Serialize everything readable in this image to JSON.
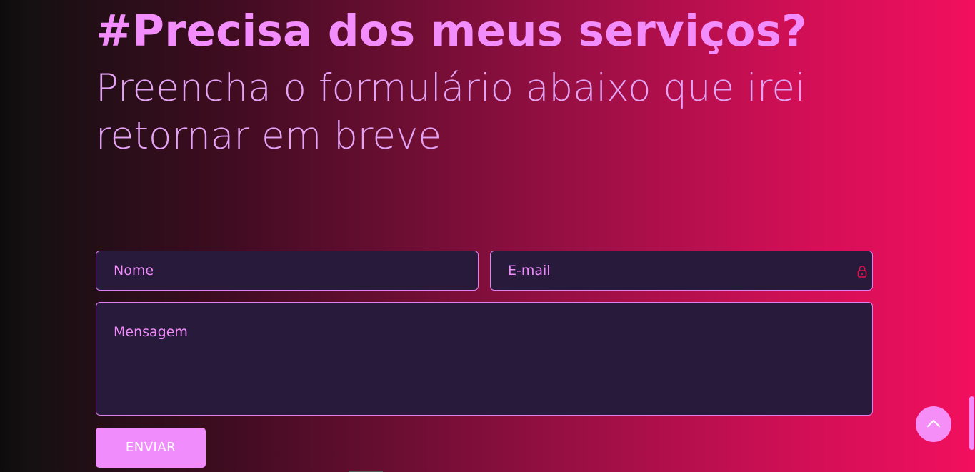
{
  "heading": {
    "title": "#Precisa dos meus serviços?",
    "subtitle": "Preencha o formulário abaixo que irei retornar em breve"
  },
  "form": {
    "name_placeholder": "Nome",
    "email_placeholder": "E-mail",
    "message_placeholder": "Mensagem",
    "submit_label": "ENVIAR"
  },
  "icons": {
    "email_field_icon": "password-manager-lock-icon",
    "back_to_top": "chevron-up-icon"
  },
  "colors": {
    "accent": "#f08cfb",
    "field_bg": "#271a3a",
    "gradient_start": "#0e0c0d",
    "gradient_end": "#f20f5e"
  }
}
